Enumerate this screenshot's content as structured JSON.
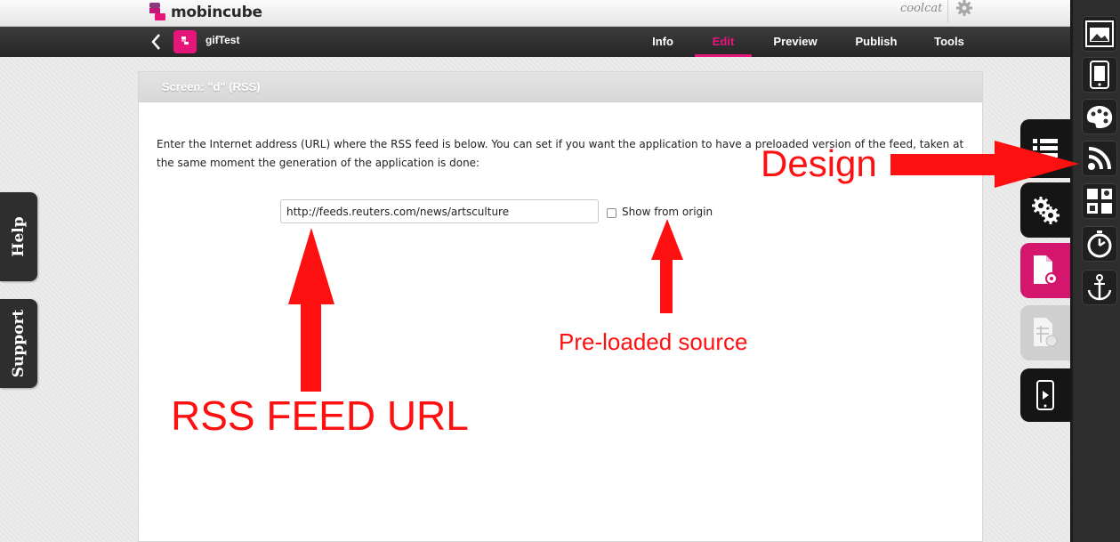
{
  "top": {
    "brand": "mobincube",
    "username": "coolcat",
    "settings_icon": "gear-icon"
  },
  "nav": {
    "back_icon": "chevron-left-icon",
    "app_icon_text": "mobincube",
    "app_name": "gifTest",
    "tabs": [
      {
        "label": "Info",
        "active": false
      },
      {
        "label": "Edit",
        "active": true
      },
      {
        "label": "Preview",
        "active": false
      },
      {
        "label": "Publish",
        "active": false
      },
      {
        "label": "Tools",
        "active": false
      }
    ]
  },
  "panel": {
    "title": "Screen: \"d\" (RSS)",
    "instructions": "Enter the Internet address (URL) where the RSS feed is below. You can set if you want the application to have a preloaded version of the feed, taken at the same moment the generation of the application is done:",
    "url_value": "http://feeds.reuters.com/news/artsculture",
    "checkbox_label": "Show from origin",
    "checkbox_checked": false
  },
  "side_tabs": {
    "help": "Help",
    "support": "Support"
  },
  "right_tabs": [
    "list-icon",
    "gears-icon",
    "document-settings-icon",
    "table-settings-icon",
    "phone-play-icon"
  ],
  "toolbar": [
    "screen-image-icon",
    "phone-icon",
    "palette-icon",
    "rss-icon",
    "grid-map-icon",
    "stopwatch-icon",
    "anchor-icon"
  ],
  "annotations": {
    "design": "Design",
    "preloaded": "Pre-loaded source",
    "rss_url": "RSS FEED URL"
  },
  "colors": {
    "accent": "#e5157a",
    "annotation": "#ff1010",
    "dark_bar": "#2d2d2d"
  }
}
